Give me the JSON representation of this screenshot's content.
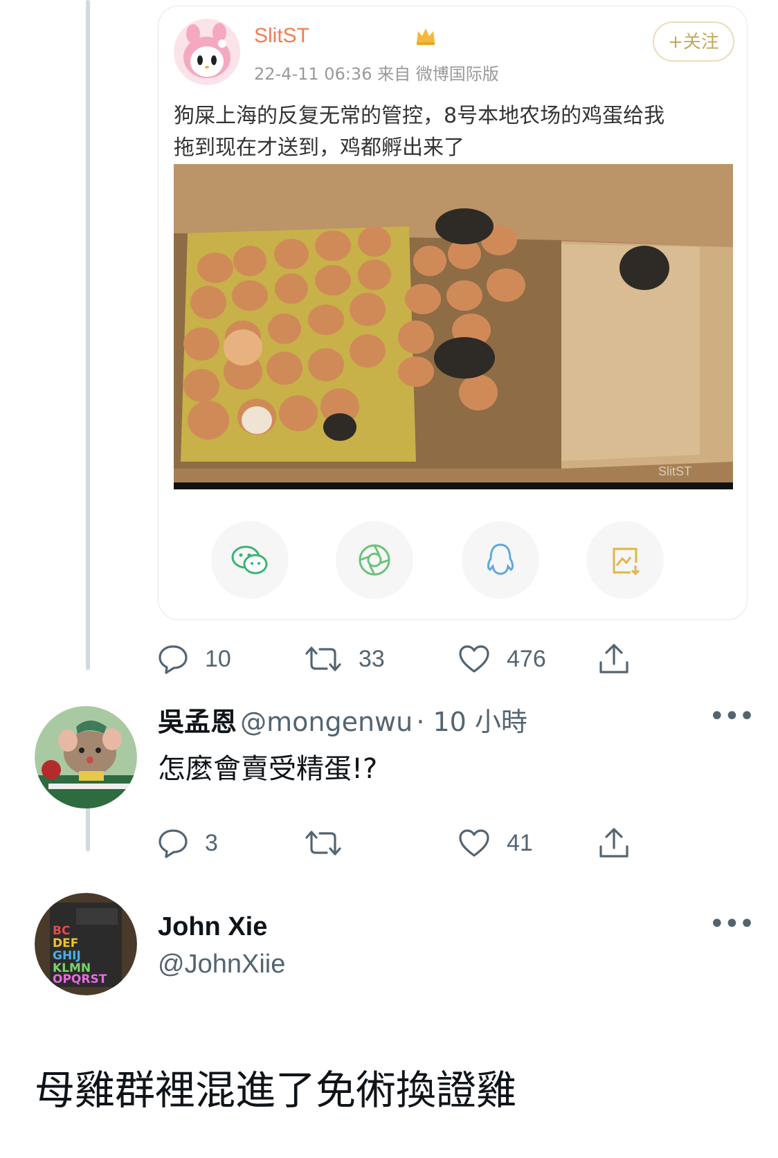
{
  "weibo_card": {
    "username": "SlitST",
    "meta": "22-4-11 06:36  来自 微博国际版",
    "follow_label": "+关注",
    "text_line1": "狗屎上海的反复无常的管控，8号本地农场的鸡蛋给我",
    "text_line2": "拖到现在才送到，鸡都孵出来了",
    "photo_watermark": "SlitST",
    "share_icons": [
      "wechat-icon",
      "moments-icon",
      "qq-icon",
      "save-image-icon"
    ]
  },
  "tweet1": {
    "replies": "10",
    "retweets": "33",
    "likes": "476"
  },
  "tweet2": {
    "name": "吳孟恩",
    "handle": "@mongenwu",
    "time": "· 10 小時",
    "text": "怎麼會賣受精蛋!?",
    "replies": "3",
    "retweets": "",
    "likes": "41"
  },
  "tweet3": {
    "name": "John Xie",
    "handle": "@JohnXiie",
    "text": "母雞群裡混進了免術換證雞"
  },
  "colors": {
    "weibo_name": "#f07d55",
    "twitter_gray": "#536471",
    "thread_line": "#cfd9de",
    "follow_gold": "#c2a760"
  }
}
